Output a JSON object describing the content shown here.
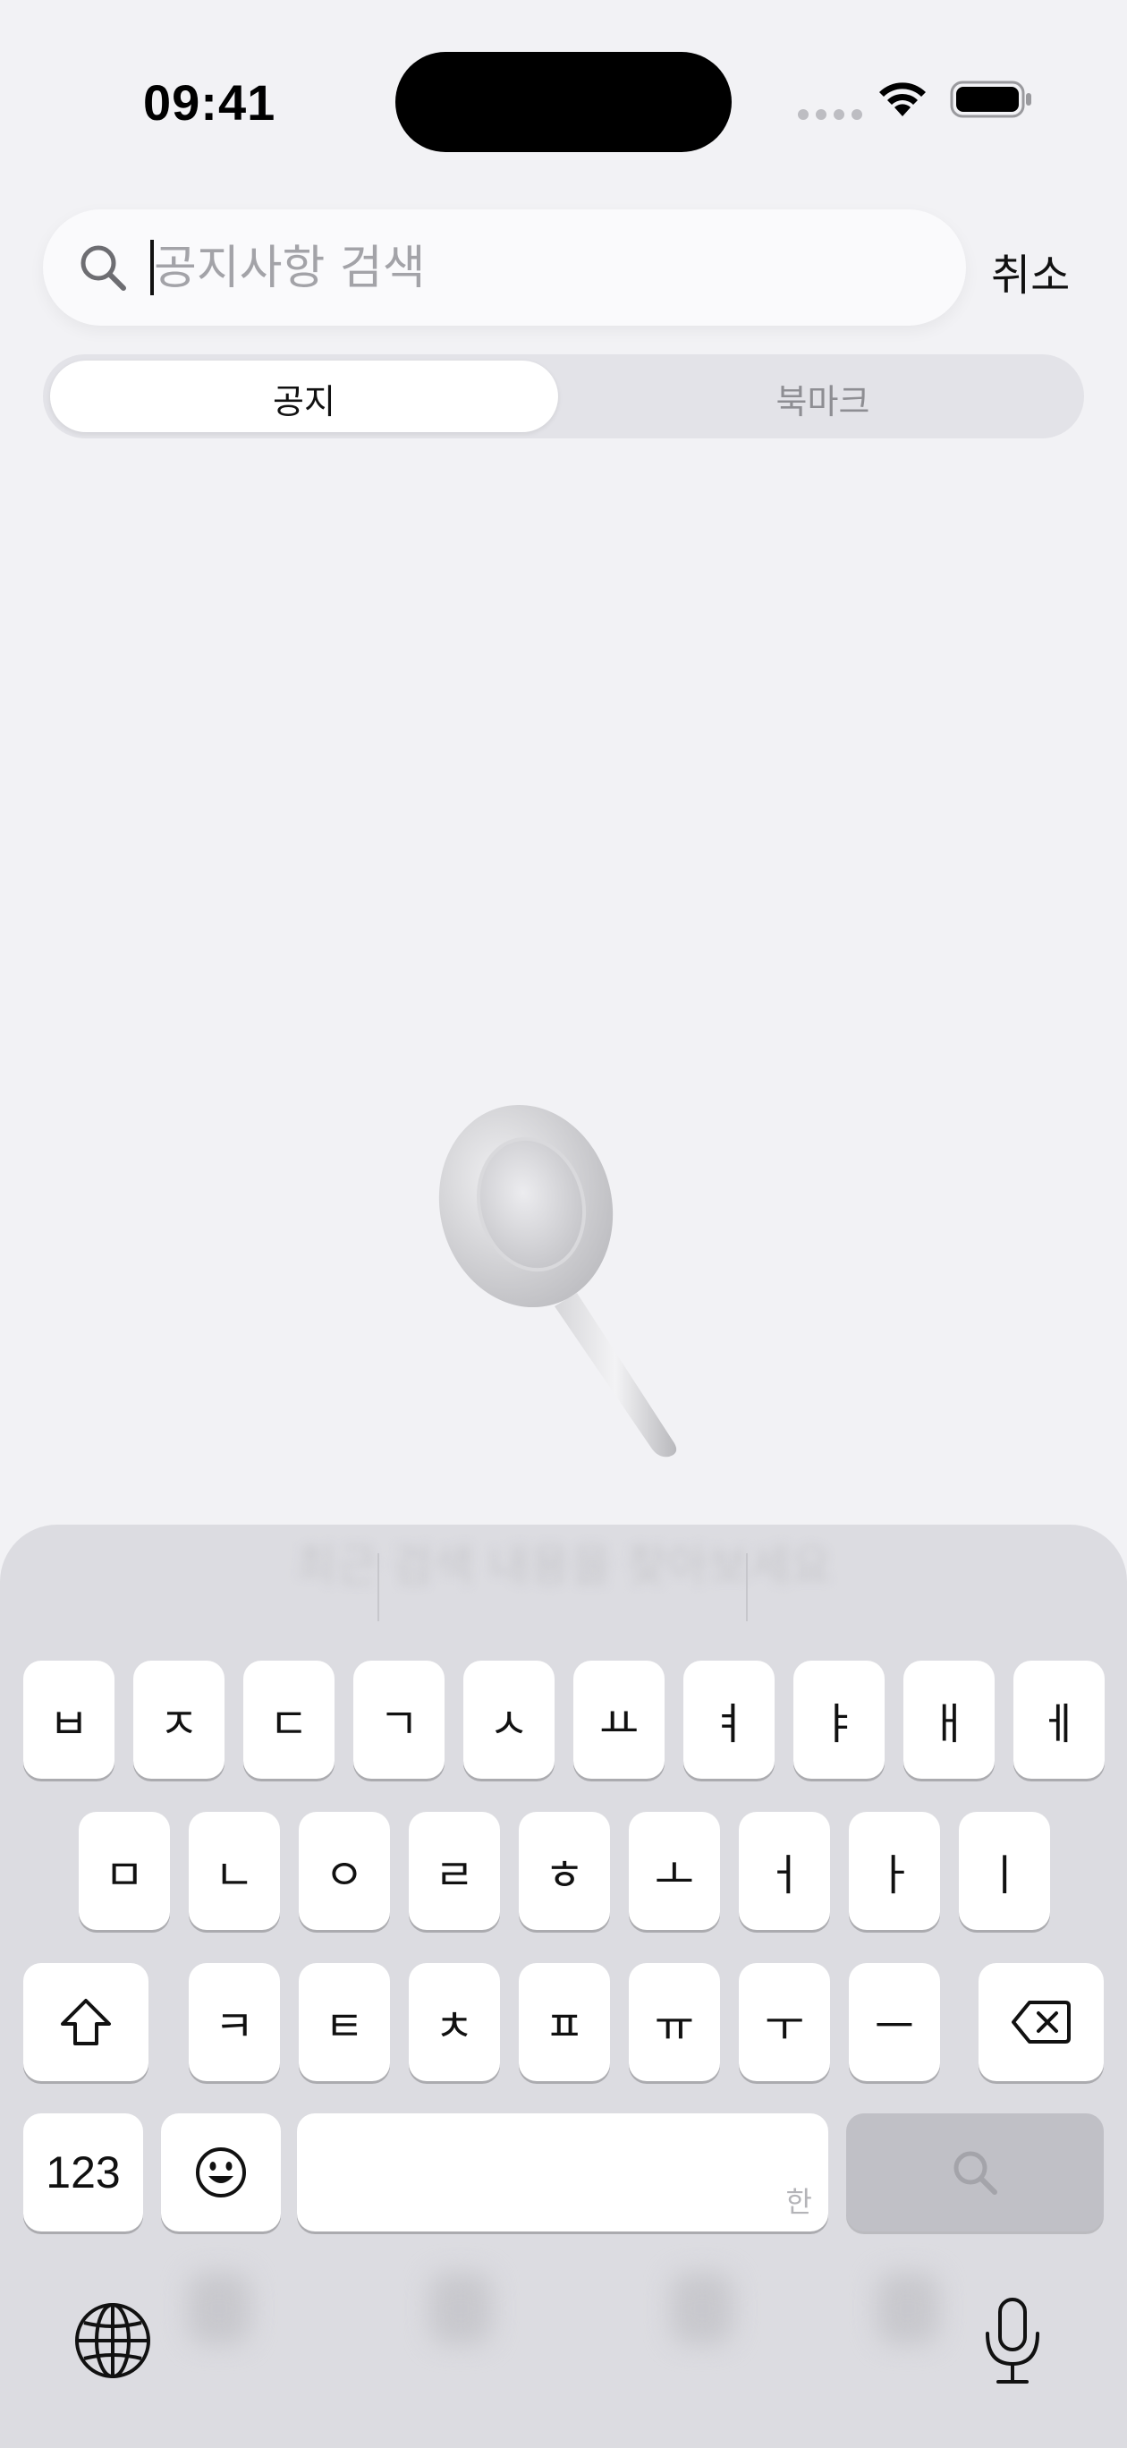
{
  "status": {
    "time": "09:41"
  },
  "search": {
    "placeholder": "공지사항 검색",
    "cancel_label": "취소"
  },
  "tabs": [
    {
      "label": "공지",
      "selected": true
    },
    {
      "label": "북마크",
      "selected": false
    }
  ],
  "keyboard": {
    "suggestion": "최근 검색 내용을 찾아보세요",
    "row1": [
      "ㅂ",
      "ㅈ",
      "ㄷ",
      "ㄱ",
      "ㅅ",
      "ㅛ",
      "ㅕ",
      "ㅑ",
      "ㅐ",
      "ㅔ"
    ],
    "row2": [
      "ㅁ",
      "ㄴ",
      "ㅇ",
      "ㄹ",
      "ㅎ",
      "ㅗ",
      "ㅓ",
      "ㅏ",
      "ㅣ"
    ],
    "row3": [
      "ㅋ",
      "ㅌ",
      "ㅊ",
      "ㅍ",
      "ㅠ",
      "ㅜ",
      "ㅡ"
    ],
    "numbers_label": "123",
    "space_hint": "한"
  },
  "colors": {
    "background": "#f2f2f5",
    "keyboard": "#dcdce1",
    "search_key": "#c0c0c6"
  }
}
